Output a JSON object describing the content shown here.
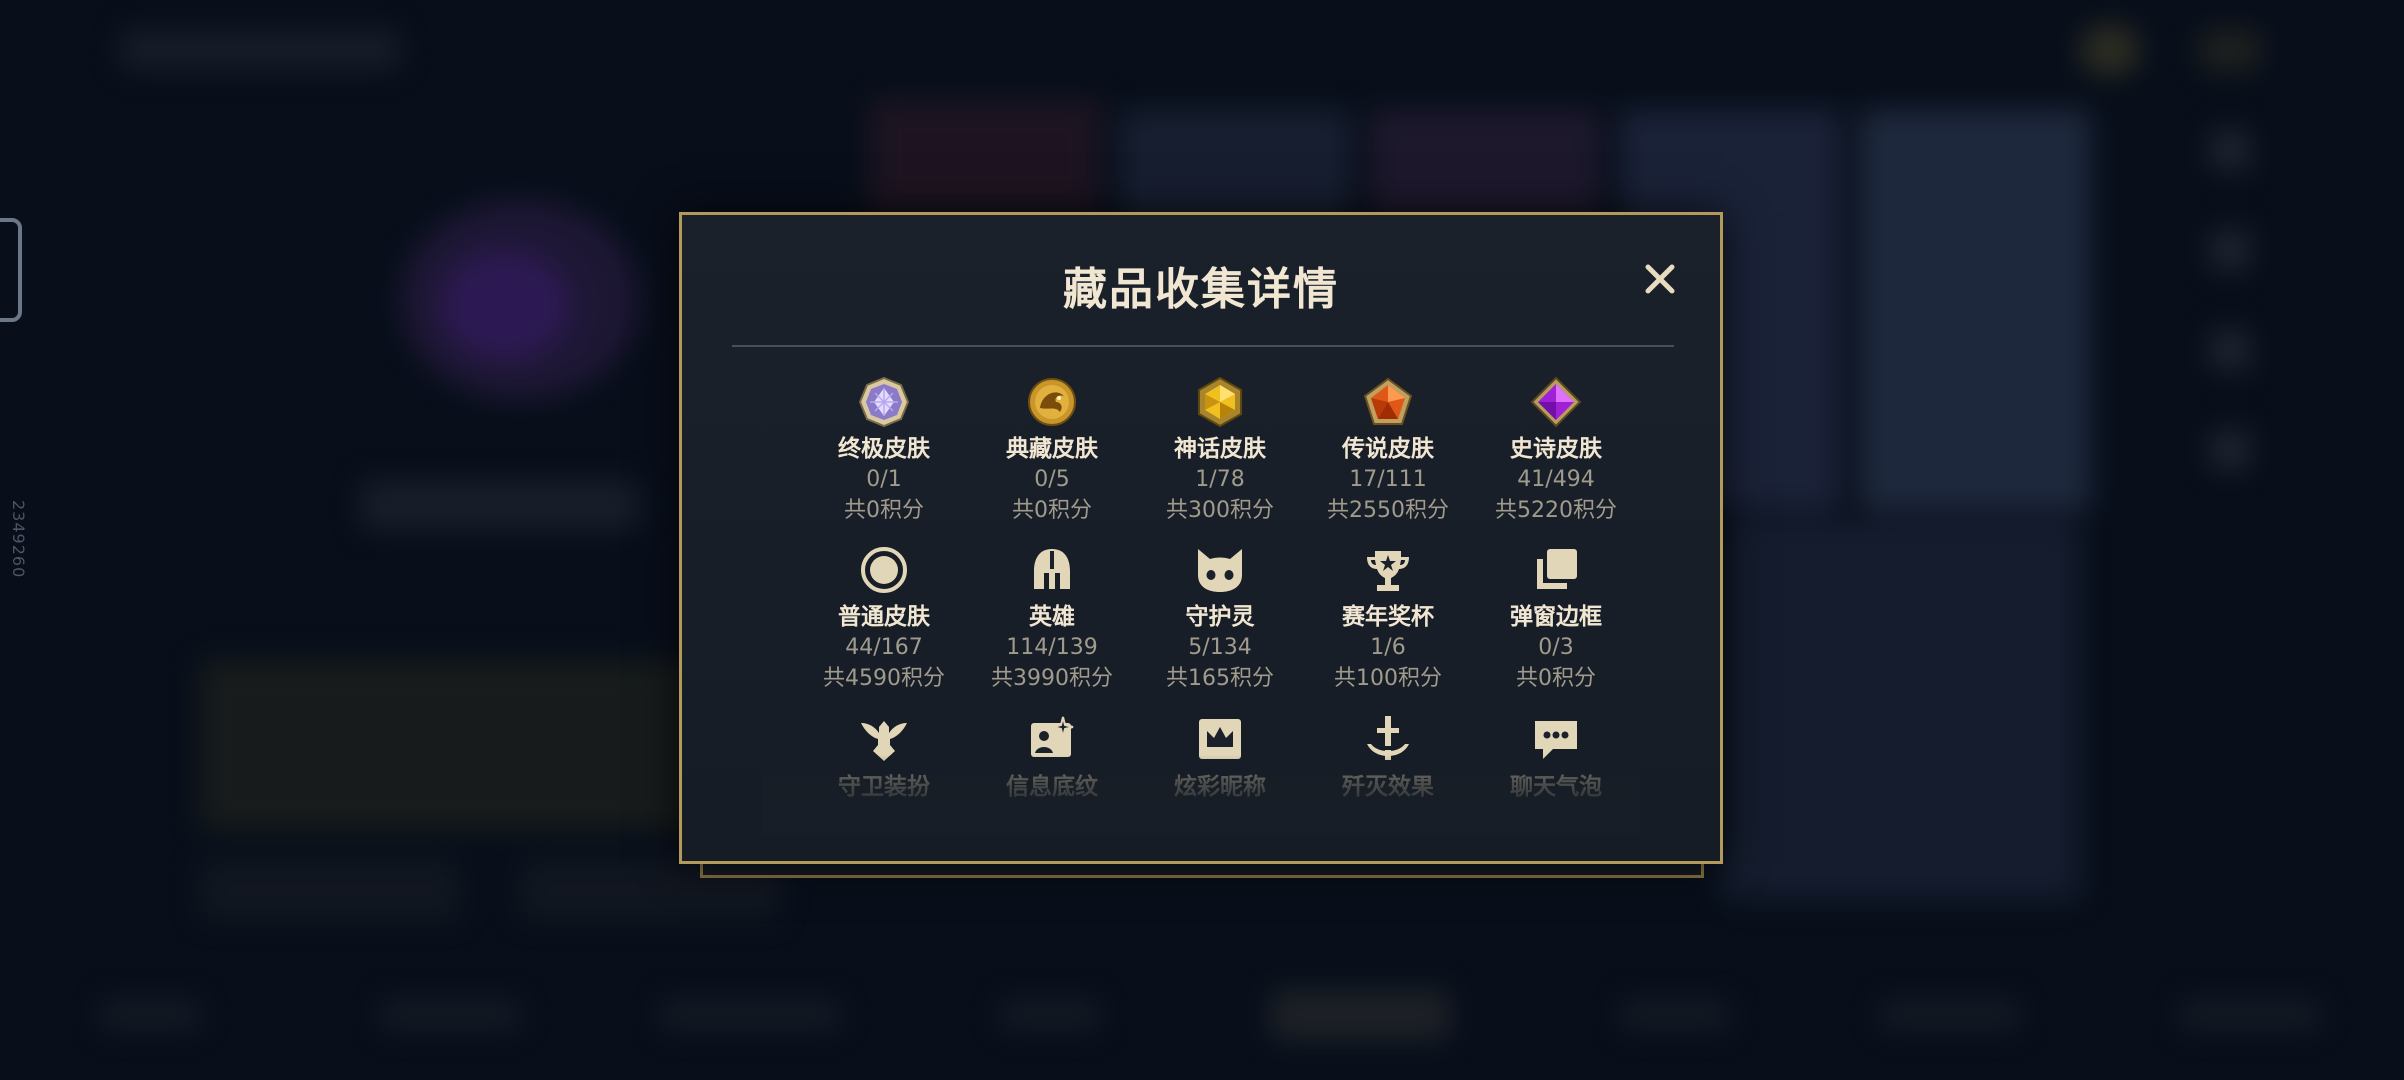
{
  "side_id": "2349260",
  "modal": {
    "title": "藏品收集详情",
    "close_label": "✕",
    "categories": [
      {
        "label": "终极皮肤",
        "count": "0/1",
        "points": "共0积分",
        "icon": "ultimate-gem-icon"
      },
      {
        "label": "典藏皮肤",
        "count": "0/5",
        "points": "共0积分",
        "icon": "dragon-emblem-icon"
      },
      {
        "label": "神话皮肤",
        "count": "1/78",
        "points": "共300积分",
        "icon": "mythic-gem-icon"
      },
      {
        "label": "传说皮肤",
        "count": "17/111",
        "points": "共2550积分",
        "icon": "legendary-gem-icon"
      },
      {
        "label": "史诗皮肤",
        "count": "41/494",
        "points": "共5220积分",
        "icon": "epic-gem-icon"
      },
      {
        "label": "普通皮肤",
        "count": "44/167",
        "points": "共4590积分",
        "icon": "ring-icon"
      },
      {
        "label": "英雄",
        "count": "114/139",
        "points": "共3990积分",
        "icon": "helmet-icon"
      },
      {
        "label": "守护灵",
        "count": "5/134",
        "points": "共165积分",
        "icon": "guardian-face-icon"
      },
      {
        "label": "赛年奖杯",
        "count": "1/6",
        "points": "共100积分",
        "icon": "trophy-icon"
      },
      {
        "label": "弹窗边框",
        "count": "0/3",
        "points": "共0积分",
        "icon": "frames-icon"
      },
      {
        "label": "守卫装扮",
        "icon": "ward-icon"
      },
      {
        "label": "信息底纹",
        "icon": "card-sparkle-icon"
      },
      {
        "label": "炫彩昵称",
        "icon": "crown-card-icon"
      },
      {
        "label": "歼灭效果",
        "icon": "sword-icon"
      },
      {
        "label": "聊天气泡",
        "icon": "chat-bubble-icon"
      }
    ]
  },
  "colors": {
    "gold": "#b49a5a",
    "title": "#f0e6d2",
    "muted": "#a09b8c",
    "panel": "#171d26"
  }
}
